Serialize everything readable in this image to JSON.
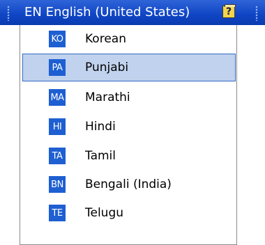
{
  "langbar": {
    "current_code": "EN",
    "current_language": "English (United States)",
    "help_glyph": "?"
  },
  "menu": {
    "items": [
      {
        "code": "KO",
        "name": "Korean"
      },
      {
        "code": "PA",
        "name": "Punjabi",
        "selected": true
      },
      {
        "code": "MA",
        "name": "Marathi"
      },
      {
        "code": "HI",
        "name": "Hindi"
      },
      {
        "code": "TA",
        "name": "Tamil"
      },
      {
        "code": "BN",
        "name": "Bengali (India)"
      },
      {
        "code": "TE",
        "name": "Telugu"
      }
    ]
  },
  "colors": {
    "bar_blue": "#0f45c4",
    "badge_blue": "#1e5fd2",
    "selection_fill": "#c1d2ee",
    "selection_border": "#316ac5"
  }
}
